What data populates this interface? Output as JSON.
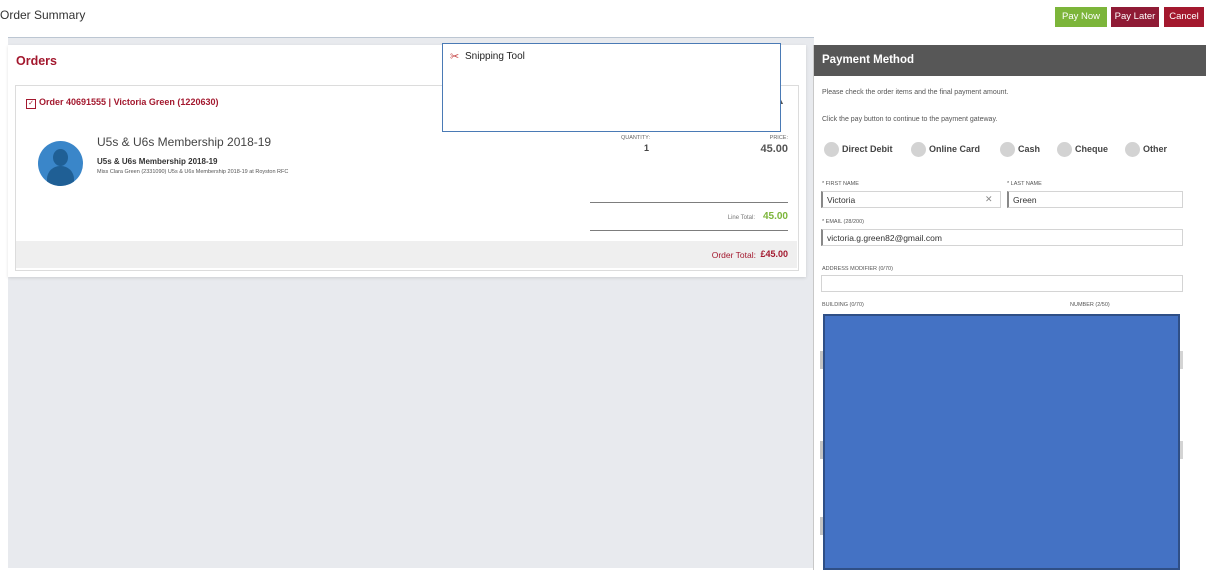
{
  "header": {
    "title": "Order Summary",
    "pay_now": "Pay Now",
    "pay_later": "Pay Later",
    "cancel": "Cancel"
  },
  "colors": {
    "accent_red": "#a3182e",
    "pay_now_green": "#7cb53a",
    "pay_later_maroon": "#8f1b35",
    "panel_header": "#575757",
    "redaction_blue": "#4472c4"
  },
  "orders": {
    "title": "Orders",
    "order": {
      "checkbox_glyph": "✓",
      "heading": "Order 40691555 | Victoria Green (1220630)",
      "item": {
        "title": "U5s & U6s Membership 2018-19",
        "subtitle": "U5s & U6s Membership 2018-19",
        "description": "Miss Clara Green (2331090) U5s & U6s Membership 2018-19 at Royston RFC",
        "quantity_label": "QUANTITY:",
        "quantity": "1",
        "price_label": "PRICE:",
        "price": "45.00"
      },
      "line_total_label": "Line Total:",
      "line_total": "45.00",
      "order_total_label": "Order Total:",
      "order_total": "£45.00"
    }
  },
  "snipping_tool": {
    "icon": "scissors-icon",
    "title": "Snipping Tool"
  },
  "payment": {
    "title": "Payment Method",
    "note1": "Please check the order items and the final payment amount.",
    "note2": "Click the pay button to continue to the payment gateway.",
    "methods": [
      "Direct Debit",
      "Online Card",
      "Cash",
      "Cheque",
      "Other"
    ],
    "first_name_label": "* FIRST NAME",
    "first_name": "Victoria",
    "last_name_label": "* LAST NAME",
    "last_name": "Green",
    "email_label": "* EMAIL (28/200)",
    "email": "victoria.g.green82@gmail.com",
    "address_modifier_label": "ADDRESS MODIFIER (0/70)",
    "address_modifier": "",
    "building_label": "BUILDING (0/70)",
    "number_label": "NUMBER (2/50)"
  }
}
